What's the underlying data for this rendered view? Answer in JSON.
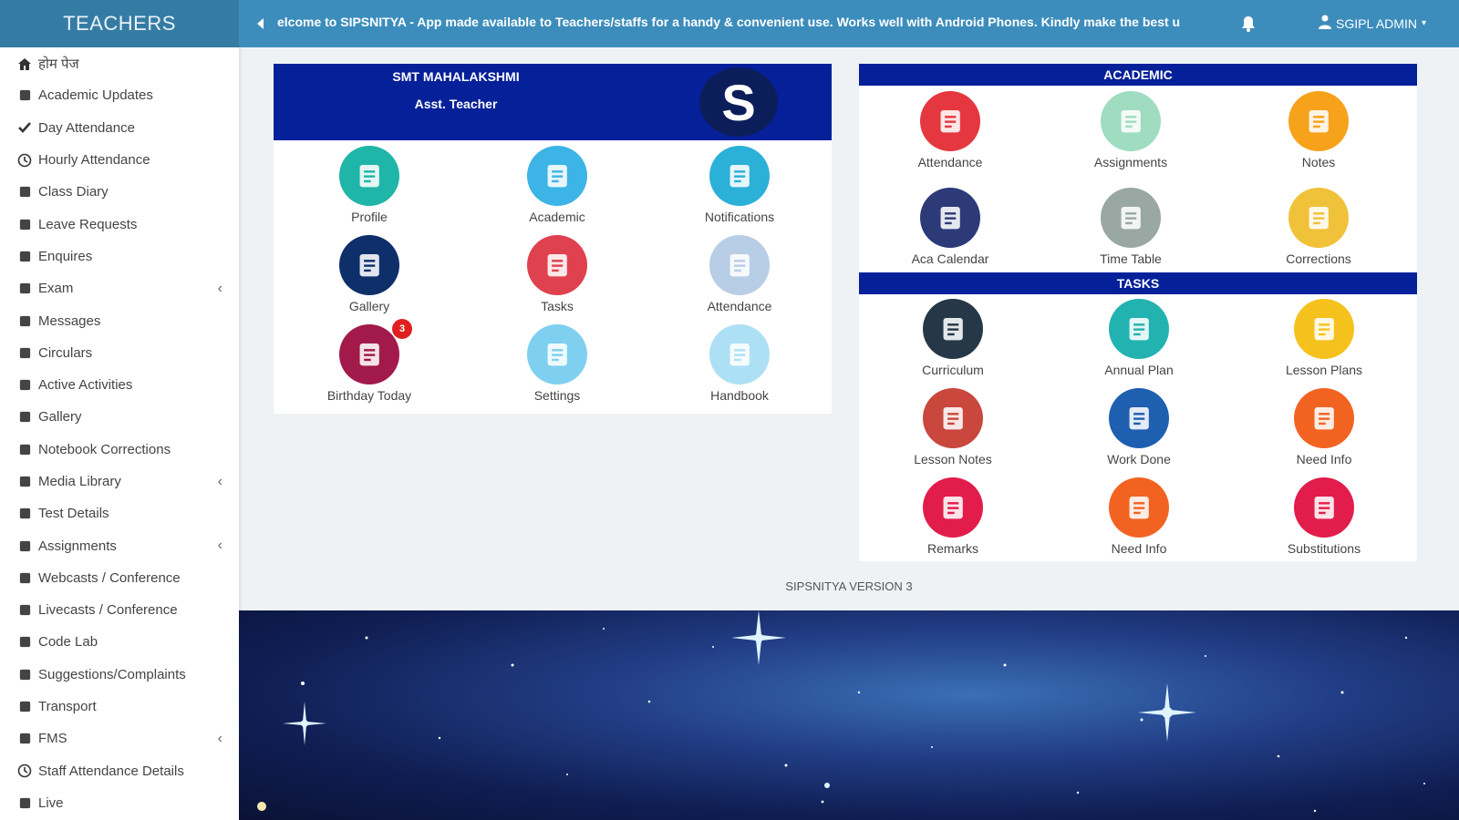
{
  "brand": "TEACHERS",
  "topbar": {
    "ticker": "elcome to SIPSNITYA - App made available to Teachers/staffs for a handy & convenient use. Works well with Android Phones. Kindly make the best u",
    "user_label": "SGIPL ADMIN"
  },
  "sidebar": {
    "items": [
      {
        "label": "होम पेज",
        "icon": "home-icon"
      },
      {
        "label": "Academic Updates",
        "icon": "edit-icon"
      },
      {
        "label": "Day Attendance",
        "icon": "check-icon"
      },
      {
        "label": "Hourly Attendance",
        "icon": "clock-icon"
      },
      {
        "label": "Class Diary",
        "icon": "book-icon"
      },
      {
        "label": "Leave Requests",
        "icon": "headphones-icon"
      },
      {
        "label": "Enquires",
        "icon": "cart-icon"
      },
      {
        "label": "Exam",
        "icon": "list-icon"
      },
      {
        "label": "Messages",
        "icon": "comment-icon"
      },
      {
        "label": "Circulars",
        "icon": "list-alt-icon"
      },
      {
        "label": "Active Activities",
        "icon": "child-icon"
      },
      {
        "label": "Gallery",
        "icon": "image-icon"
      },
      {
        "label": "Notebook Corrections",
        "icon": "recycle-icon"
      },
      {
        "label": "Media Library",
        "icon": "camera-icon"
      },
      {
        "label": "Test Details",
        "icon": "question-icon"
      },
      {
        "label": "Assignments",
        "icon": "user-tie-icon"
      },
      {
        "label": "Webcasts / Conference",
        "icon": "globe-icon"
      },
      {
        "label": "Livecasts / Conference",
        "icon": "video-icon"
      },
      {
        "label": "Code Lab",
        "icon": "code-icon"
      },
      {
        "label": "Suggestions/Complaints",
        "icon": "fire-icon"
      },
      {
        "label": "Transport",
        "icon": "bus-icon"
      },
      {
        "label": "FMS",
        "icon": "link-icon"
      },
      {
        "label": "Staff Attendance Details",
        "icon": "clock-icon"
      },
      {
        "label": "Live",
        "icon": "video-icon"
      }
    ]
  },
  "profile": {
    "name": "SMT MAHALAKSHMI",
    "role": "Asst. Teacher",
    "avatar_letter": "S",
    "tiles": [
      {
        "label": "Profile",
        "color": "#1fb5a8"
      },
      {
        "label": "Academic",
        "color": "#3cb4e6"
      },
      {
        "label": "Notifications",
        "color": "#2bb0d8"
      },
      {
        "label": "Gallery",
        "color": "#0f2f6b"
      },
      {
        "label": "Tasks",
        "color": "#e0414f"
      },
      {
        "label": "Attendance",
        "color": "#b8cde6"
      },
      {
        "label": "Birthday Today",
        "color": "#a21a4a",
        "badge": "3"
      },
      {
        "label": "Settings",
        "color": "#7fd0f0"
      },
      {
        "label": "Handbook",
        "color": "#aee0f5"
      }
    ]
  },
  "academic": {
    "title": "ACADEMIC",
    "tiles": [
      {
        "label": "Attendance",
        "color": "#e5373f"
      },
      {
        "label": "Assignments",
        "color": "#9fdcc0"
      },
      {
        "label": "Notes",
        "color": "#f7a21b"
      },
      {
        "label": "Aca Calendar",
        "color": "#2c3a78"
      },
      {
        "label": "Time Table",
        "color": "#9aa8a4"
      },
      {
        "label": "Corrections",
        "color": "#f0c23a"
      }
    ]
  },
  "tasks": {
    "title": "TASKS",
    "tiles": [
      {
        "label": "Curriculum",
        "color": "#263848"
      },
      {
        "label": "Annual Plan",
        "color": "#22b3b0"
      },
      {
        "label": "Lesson Plans",
        "color": "#f5c21d"
      },
      {
        "label": "Lesson Notes",
        "color": "#c9473d"
      },
      {
        "label": "Work Done",
        "color": "#1e5fb0"
      },
      {
        "label": "Need Info",
        "color": "#f26322"
      },
      {
        "label": "Remarks",
        "color": "#e21d4b"
      },
      {
        "label": "Need Info",
        "color": "#f26322"
      },
      {
        "label": "Substitutions",
        "color": "#e21d4b"
      }
    ]
  },
  "footer": {
    "version": "SIPSNITYA VERSION 3"
  }
}
